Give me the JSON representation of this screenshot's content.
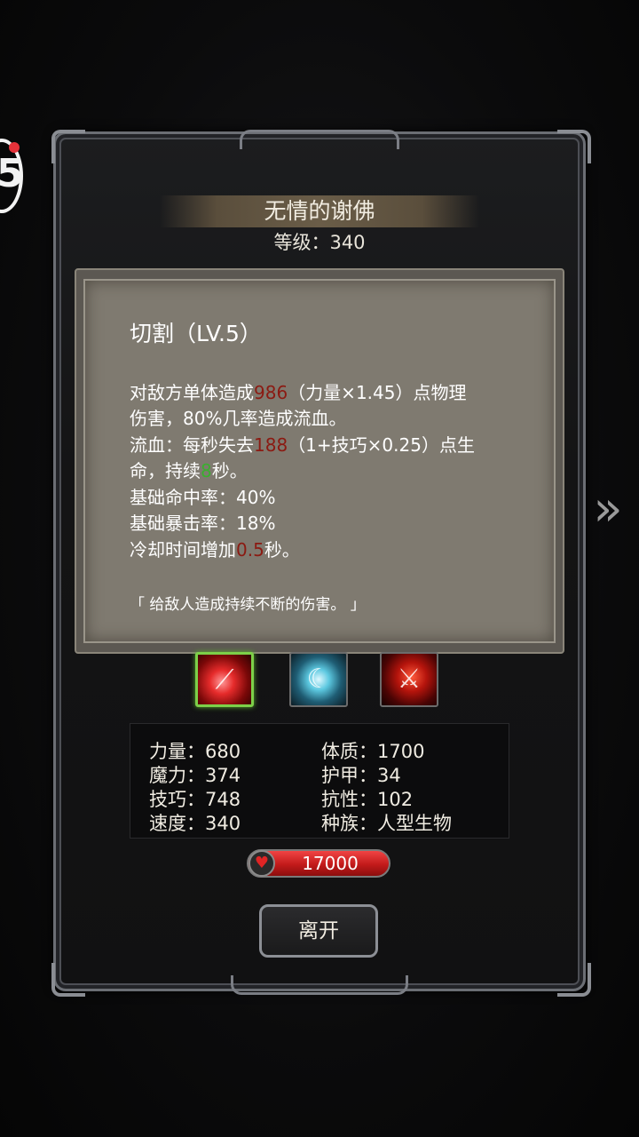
{
  "badge": {
    "number": "5"
  },
  "header": {
    "name": "无情的谢佛",
    "level": "等级：340"
  },
  "skill": {
    "title": "切割（LV.5）",
    "line1_a": "对敌方单体造成",
    "line1_dmg": "986",
    "line1_b": "（力量×1.45）点物理",
    "line2": "伤害，80%几率造成流血。",
    "line3_a": "流血：每秒失去",
    "line3_bleed": "188",
    "line3_b": "（1+技巧×0.25）点生",
    "line4_a": "命，持续",
    "line4_dur": "8",
    "line4_b": "秒。",
    "line5": "基础命中率：40%",
    "line6": "基础暴击率：18%",
    "line7_a": "冷却时间增加",
    "line7_cd": "0.5",
    "line7_b": "秒。",
    "quote": "「 给敌人造成持续不断的伤害。 」"
  },
  "skill_icons": [
    {
      "name": "slash-skill-icon",
      "selected": true
    },
    {
      "name": "frost-slash-skill-icon",
      "selected": false
    },
    {
      "name": "blood-blade-skill-icon",
      "selected": false
    }
  ],
  "stats": {
    "strength": "力量：680",
    "magic": "魔力：374",
    "skill": "技巧：748",
    "speed": "速度：340",
    "constitution": "体质：1700",
    "armor": "护甲：34",
    "resistance": "抗性：102",
    "race": "种族：人型生物"
  },
  "hp": {
    "value": "17000"
  },
  "actions": {
    "leave": "离开"
  },
  "colors": {
    "damage": "#8b1a12",
    "duration": "#3ab02e",
    "selected_border": "#7dd049"
  }
}
